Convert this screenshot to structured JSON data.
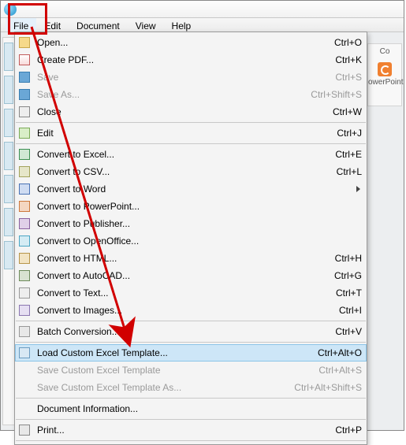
{
  "menubar": {
    "file": "File",
    "edit": "Edit",
    "document": "Document",
    "view": "View",
    "help": "Help"
  },
  "rightPanel": {
    "topLabel": "Co",
    "pptLabel": "owerPoint"
  },
  "menu": {
    "open": {
      "label": "Open...",
      "shortcut": "Ctrl+O"
    },
    "createPdf": {
      "label": "Create PDF...",
      "shortcut": "Ctrl+K"
    },
    "save": {
      "label": "Save",
      "shortcut": "Ctrl+S"
    },
    "saveAs": {
      "label": "Save As...",
      "shortcut": "Ctrl+Shift+S"
    },
    "close": {
      "label": "Close",
      "shortcut": "Ctrl+W"
    },
    "editMode": {
      "label": "Edit",
      "shortcut": "Ctrl+J"
    },
    "toExcel": {
      "label": "Convert to Excel...",
      "shortcut": "Ctrl+E"
    },
    "toCsv": {
      "label": "Convert to CSV...",
      "shortcut": "Ctrl+L"
    },
    "toWord": {
      "label": "Convert to Word",
      "shortcut": ""
    },
    "toPpt": {
      "label": "Convert to PowerPoint...",
      "shortcut": ""
    },
    "toPub": {
      "label": "Convert to Publisher...",
      "shortcut": ""
    },
    "toOO": {
      "label": "Convert to OpenOffice...",
      "shortcut": ""
    },
    "toHtml": {
      "label": "Convert to HTML...",
      "shortcut": "Ctrl+H"
    },
    "toCad": {
      "label": "Convert to AutoCAD...",
      "shortcut": "Ctrl+G"
    },
    "toText": {
      "label": "Convert to Text...",
      "shortcut": "Ctrl+T"
    },
    "toImages": {
      "label": "Convert to Images...",
      "shortcut": "Ctrl+I"
    },
    "batch": {
      "label": "Batch Conversion...",
      "shortcut": "Ctrl+V"
    },
    "loadTpl": {
      "label": "Load Custom Excel Template...",
      "shortcut": "Ctrl+Alt+O"
    },
    "saveTpl": {
      "label": "Save Custom Excel Template",
      "shortcut": "Ctrl+Alt+S"
    },
    "saveTplAs": {
      "label": "Save Custom Excel Template As...",
      "shortcut": "Ctrl+Alt+Shift+S"
    },
    "docInfo": {
      "label": "Document Information...",
      "shortcut": ""
    },
    "print": {
      "label": "Print...",
      "shortcut": "Ctrl+P"
    }
  }
}
